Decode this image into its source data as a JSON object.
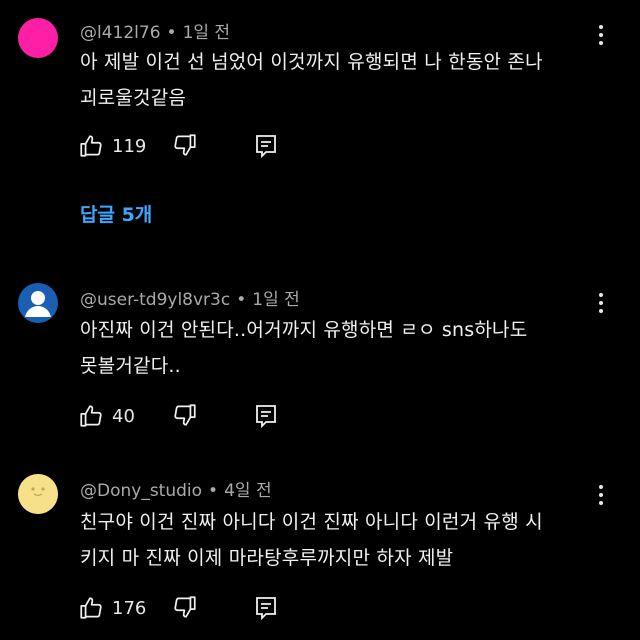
{
  "colors": {
    "background": "#000000",
    "text": "#f1f1f1",
    "meta": "#aaaaaa",
    "link": "#3ea6ff"
  },
  "comments": [
    {
      "author": "@l412l76",
      "time": "1일 전",
      "lines": [
        "아 제발 이건 선 넘었어 이것까지 유행되면 나 한동안 존나",
        "괴로울것같음"
      ],
      "likes": "119",
      "avatar": "pink-circle"
    },
    {
      "author": "@user-td9yl8vr3c",
      "time": "1일 전",
      "lines": [
        "아진짜 이건 안된다..어거까지 유행하면 ㄹㅇ sns하나도",
        "못볼거같다.."
      ],
      "likes": "40",
      "avatar": "default-user-avatar"
    },
    {
      "author": "@Dony_studio",
      "time": "4일 전",
      "lines": [
        "친구야 이건 진짜 아니다 이건 진짜 아니다 이런거 유행 시",
        "키지 마 진짜 이제 마라탕후루까지만 하자 제발"
      ],
      "likes": "176",
      "avatar": "yellow-character"
    }
  ],
  "replies_link": "답글 5개"
}
